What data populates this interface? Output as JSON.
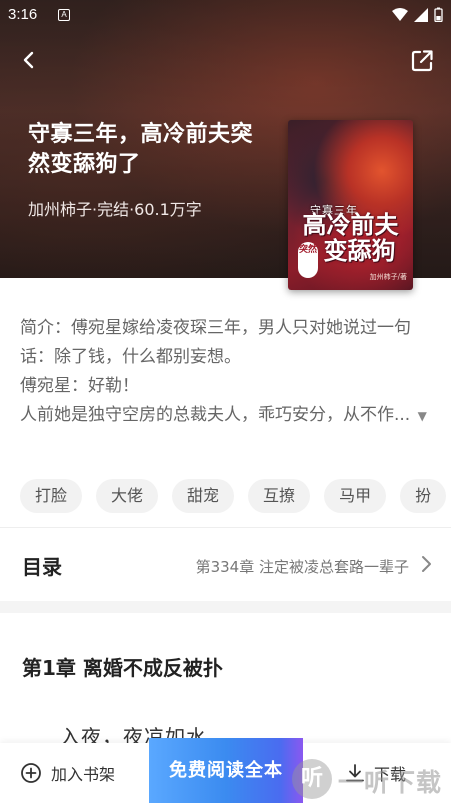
{
  "status_bar": {
    "time": "3:16",
    "notification_letter": "A"
  },
  "book": {
    "title": "守寡三年，高冷前夫突然变舔狗了",
    "meta": "加州柿子·完结·60.1万字",
    "cover": {
      "sub_top": "守寡三年",
      "title_line1": "高冷前夫",
      "title_line2": "变舔狗",
      "badge": "突然",
      "author": "加州柿子/著"
    }
  },
  "intro": {
    "text": "简介：傅宛星嫁给凌夜琛三年，男人只对她说过一句话：除了钱，什么都别妄想。\n傅宛星：好勒！\n人前她是独守空房的总裁夫人，乖巧安分，从不作...",
    "toggle_icon": "triangle-down-icon"
  },
  "tags": [
    "打脸",
    "大佬",
    "甜宠",
    "互撩",
    "马甲",
    "扮"
  ],
  "toc": {
    "label": "目录",
    "latest": "第334章 注定被凌总套路一辈子"
  },
  "chapter": {
    "title": "第1章 离婚不成反被扑",
    "first_line": "入夜，夜凉如水"
  },
  "bottom_bar": {
    "add_shelf": "加入书架",
    "read_free": "免费阅读全本",
    "download": "下载"
  },
  "watermark": {
    "glyph": "听",
    "text": "一听下载"
  },
  "colors": {
    "accent_blue": "#3b8bf0",
    "accent_purple": "#8a58f0",
    "tag_bg": "#f2f2f2"
  }
}
